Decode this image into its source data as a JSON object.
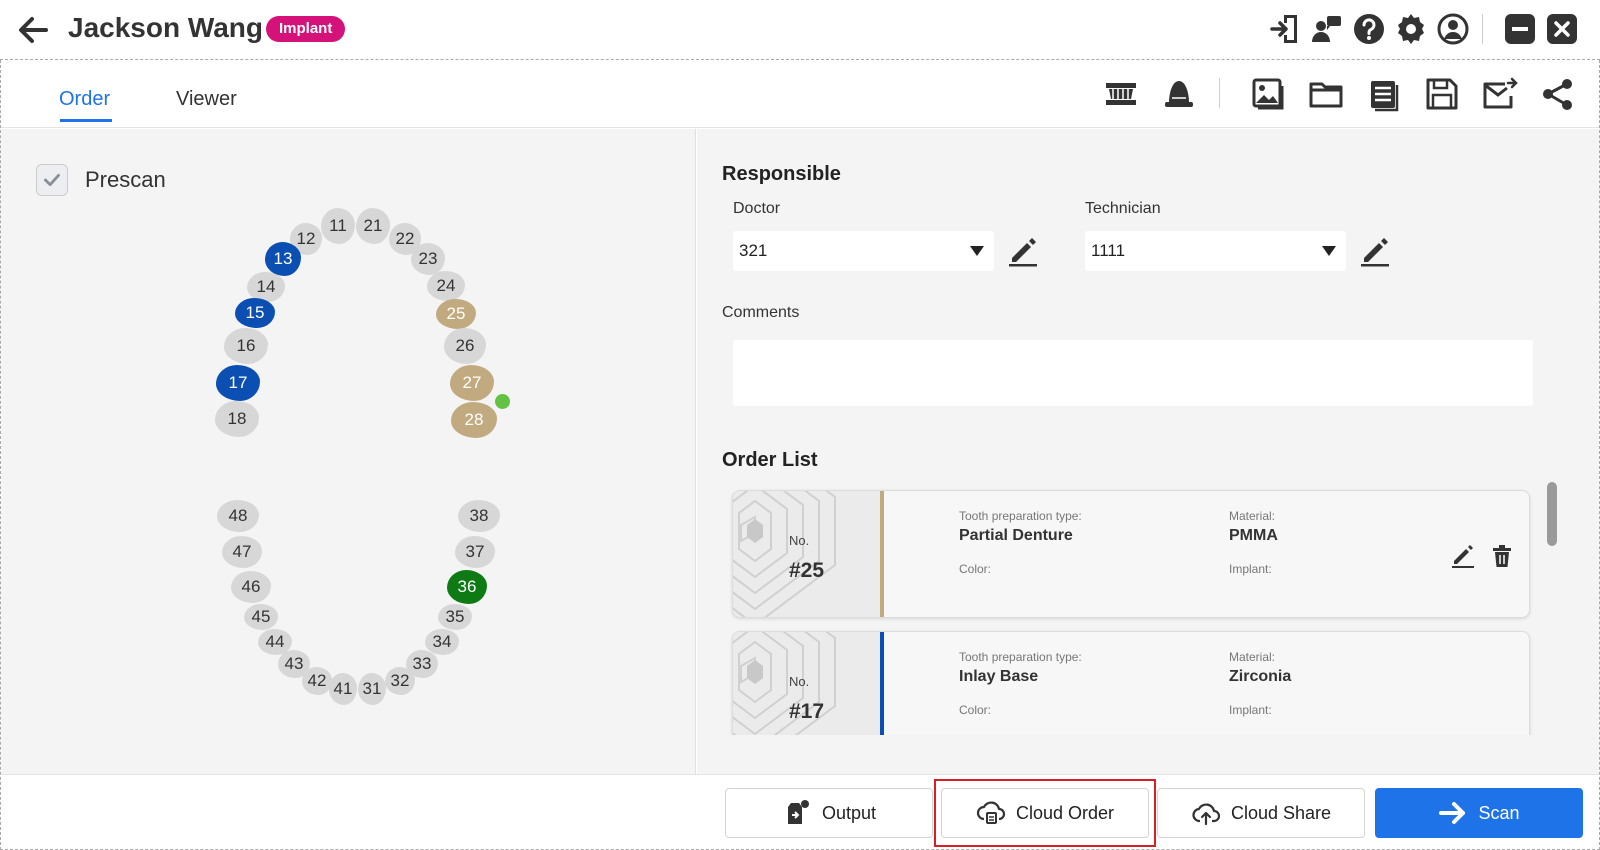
{
  "header": {
    "patient_name": "Jackson Wang",
    "badge": "Implant",
    "icons": [
      "back-arrow-icon",
      "import-icon",
      "chat-icon",
      "help-icon",
      "settings-icon",
      "account-icon",
      "minimize-icon",
      "close-icon"
    ]
  },
  "tabs": {
    "order": "Order",
    "viewer": "Viewer",
    "active": "Order"
  },
  "toolbar": {
    "icons": [
      "lower-jaw-icon",
      "upper-jaw-icon",
      "gallery-icon",
      "folder-icon",
      "notes-icon",
      "save-icon",
      "mail-icon",
      "share-icon"
    ]
  },
  "left": {
    "prescan_label": "Prescan",
    "prescan_checked": true,
    "teeth": {
      "t11": "11",
      "t12": "12",
      "t13": "13",
      "t14": "14",
      "t15": "15",
      "t16": "16",
      "t17": "17",
      "t18": "18",
      "t21": "21",
      "t22": "22",
      "t23": "23",
      "t24": "24",
      "t25": "25",
      "t26": "26",
      "t27": "27",
      "t28": "28",
      "t31": "31",
      "t32": "32",
      "t33": "33",
      "t34": "34",
      "t35": "35",
      "t36": "36",
      "t37": "37",
      "t38": "38",
      "t41": "41",
      "t42": "42",
      "t43": "43",
      "t44": "44",
      "t45": "45",
      "t46": "46",
      "t47": "47",
      "t48": "48"
    },
    "colors": {
      "blue": "#0b4fb3",
      "tan": "#c1aa80",
      "green": "#0d7a14",
      "default": "#d7d7d7",
      "dot": "#63c244"
    }
  },
  "responsible": {
    "title": "Responsible",
    "doctor_label": "Doctor",
    "doctor_value": "321",
    "technician_label": "Technician",
    "technician_value": "1111",
    "comments_label": "Comments",
    "comments_value": ""
  },
  "order_list": {
    "title": "Order List",
    "items": [
      {
        "no_label": "No.",
        "number": "#25",
        "prep_label": "Tooth preparation type:",
        "prep_value": "Partial Denture",
        "material_label": "Material:",
        "material_value": "PMMA",
        "color_label": "Color:",
        "implant_label": "Implant:",
        "stripe_color": "#c1aa80"
      },
      {
        "no_label": "No.",
        "number": "#17",
        "prep_label": "Tooth preparation type:",
        "prep_value": "Inlay Base",
        "material_label": "Material:",
        "material_value": "Zirconia",
        "color_label": "Color:",
        "implant_label": "Implant:",
        "stripe_color": "#0b4fb3"
      }
    ]
  },
  "bottom": {
    "output": "Output",
    "cloud_order": "Cloud Order",
    "cloud_share": "Cloud Share",
    "scan": "Scan",
    "accent": "#1e73e8",
    "highlight_color": "#d61f26"
  }
}
